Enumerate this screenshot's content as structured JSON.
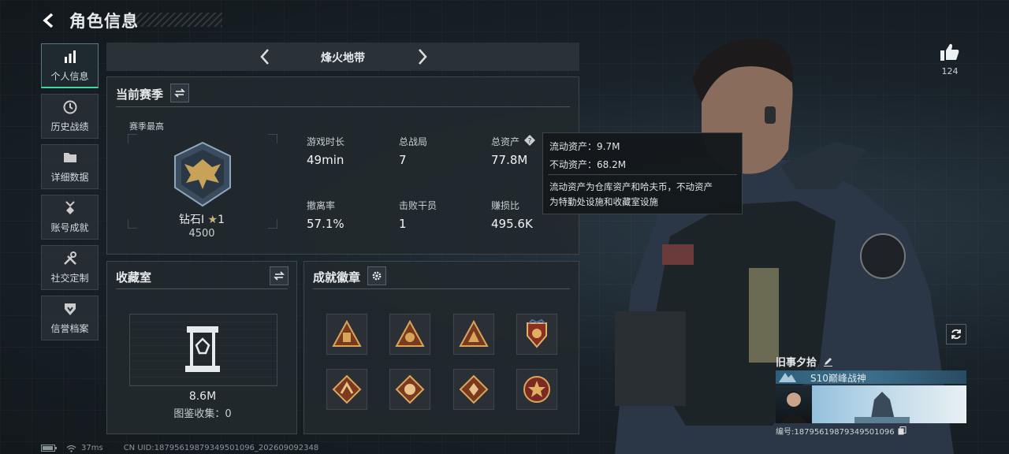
{
  "header": {
    "title": "角色信息"
  },
  "nav": [
    {
      "label": "个人信息",
      "icon": "bar-chart-icon"
    },
    {
      "label": "历史战绩",
      "icon": "clock-icon"
    },
    {
      "label": "详细数据",
      "icon": "folder-icon"
    },
    {
      "label": "账号成就",
      "icon": "medal-icon"
    },
    {
      "label": "社交定制",
      "icon": "tools-icon"
    },
    {
      "label": "信誉档案",
      "icon": "shield-icon"
    }
  ],
  "mode_tab": {
    "name": "烽火地带"
  },
  "season": {
    "title": "当前赛季",
    "best_label": "赛季最高",
    "rank": "钻石I",
    "stars": "1",
    "points": "4500",
    "stats": [
      {
        "label": "游戏时长",
        "value": "49min"
      },
      {
        "label": "总战局",
        "value": "7"
      },
      {
        "label": "总资产",
        "value": "77.8M"
      },
      {
        "label": "撤离率",
        "value": "57.1%"
      },
      {
        "label": "击败干员",
        "value": "1"
      },
      {
        "label": "赚损比",
        "value": "495.6K"
      }
    ]
  },
  "tooltip": {
    "liquid": "流动资产：9.7M",
    "fixed": "不动资产：68.2M",
    "note_line1": "流动资产为仓库资产和哈夫币，不动资产",
    "note_line2": "为特勤处设施和收藏室设施"
  },
  "collection": {
    "title": "收藏室",
    "value": "8.6M",
    "catalog": "图鉴收集：0"
  },
  "achievements": {
    "title": "成就徽章"
  },
  "likes": {
    "count": "124"
  },
  "profile": {
    "name": "旧事夕拾",
    "title": "S10巅峰战神",
    "id": "编号:18795619879349501096"
  },
  "footer": {
    "ping": "37ms",
    "uid": "CN UID:18795619879349501096_202609092348"
  },
  "colors": {
    "accent": "#3fd7a0",
    "panel": "#22292e"
  }
}
